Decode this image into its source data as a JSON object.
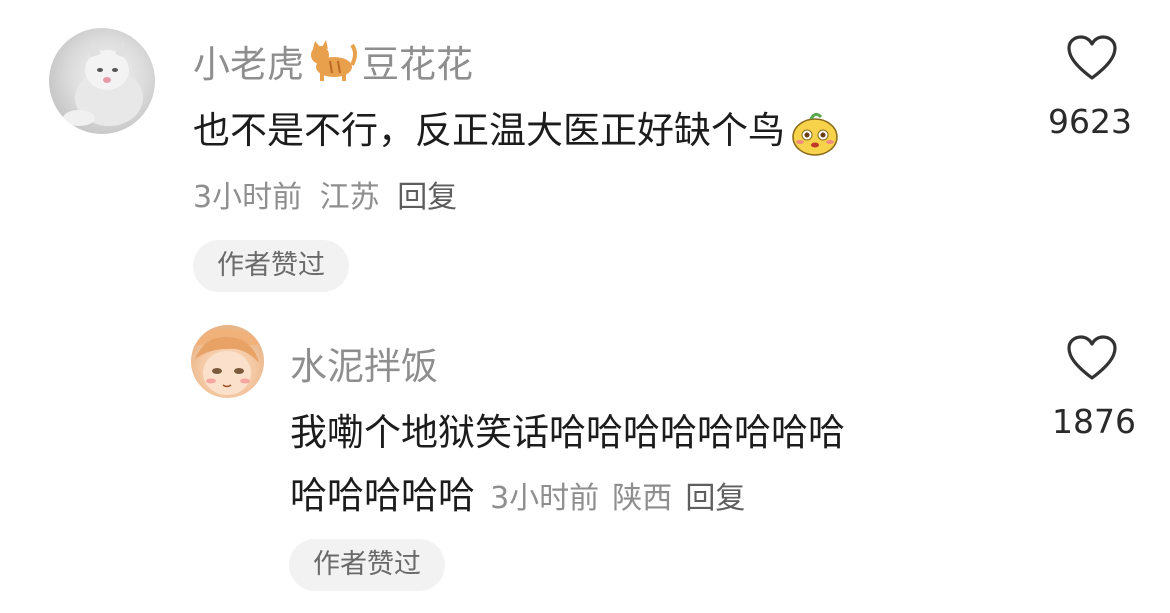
{
  "comments": [
    {
      "user_prefix": "小老虎",
      "user_suffix": "豆花花",
      "user_emoji": "cat-emoji",
      "text": "也不是不行，反正温大医正好缺个鸟",
      "text_emoji": "blushing-face-emoji",
      "time": "3小时前",
      "location": "江苏",
      "reply_label": "回复",
      "badge": "作者赞过",
      "likes": "9623"
    },
    {
      "user": "水泥拌饭",
      "text_line1": "我嘞个地狱笑话哈哈哈哈哈哈哈哈",
      "text_line2": "哈哈哈哈哈",
      "time": "3小时前",
      "location": "陕西",
      "reply_label": "回复",
      "badge": "作者赞过",
      "likes": "1876"
    }
  ],
  "icons": {
    "like": "heart-outline-icon",
    "like_color": "#333333"
  }
}
